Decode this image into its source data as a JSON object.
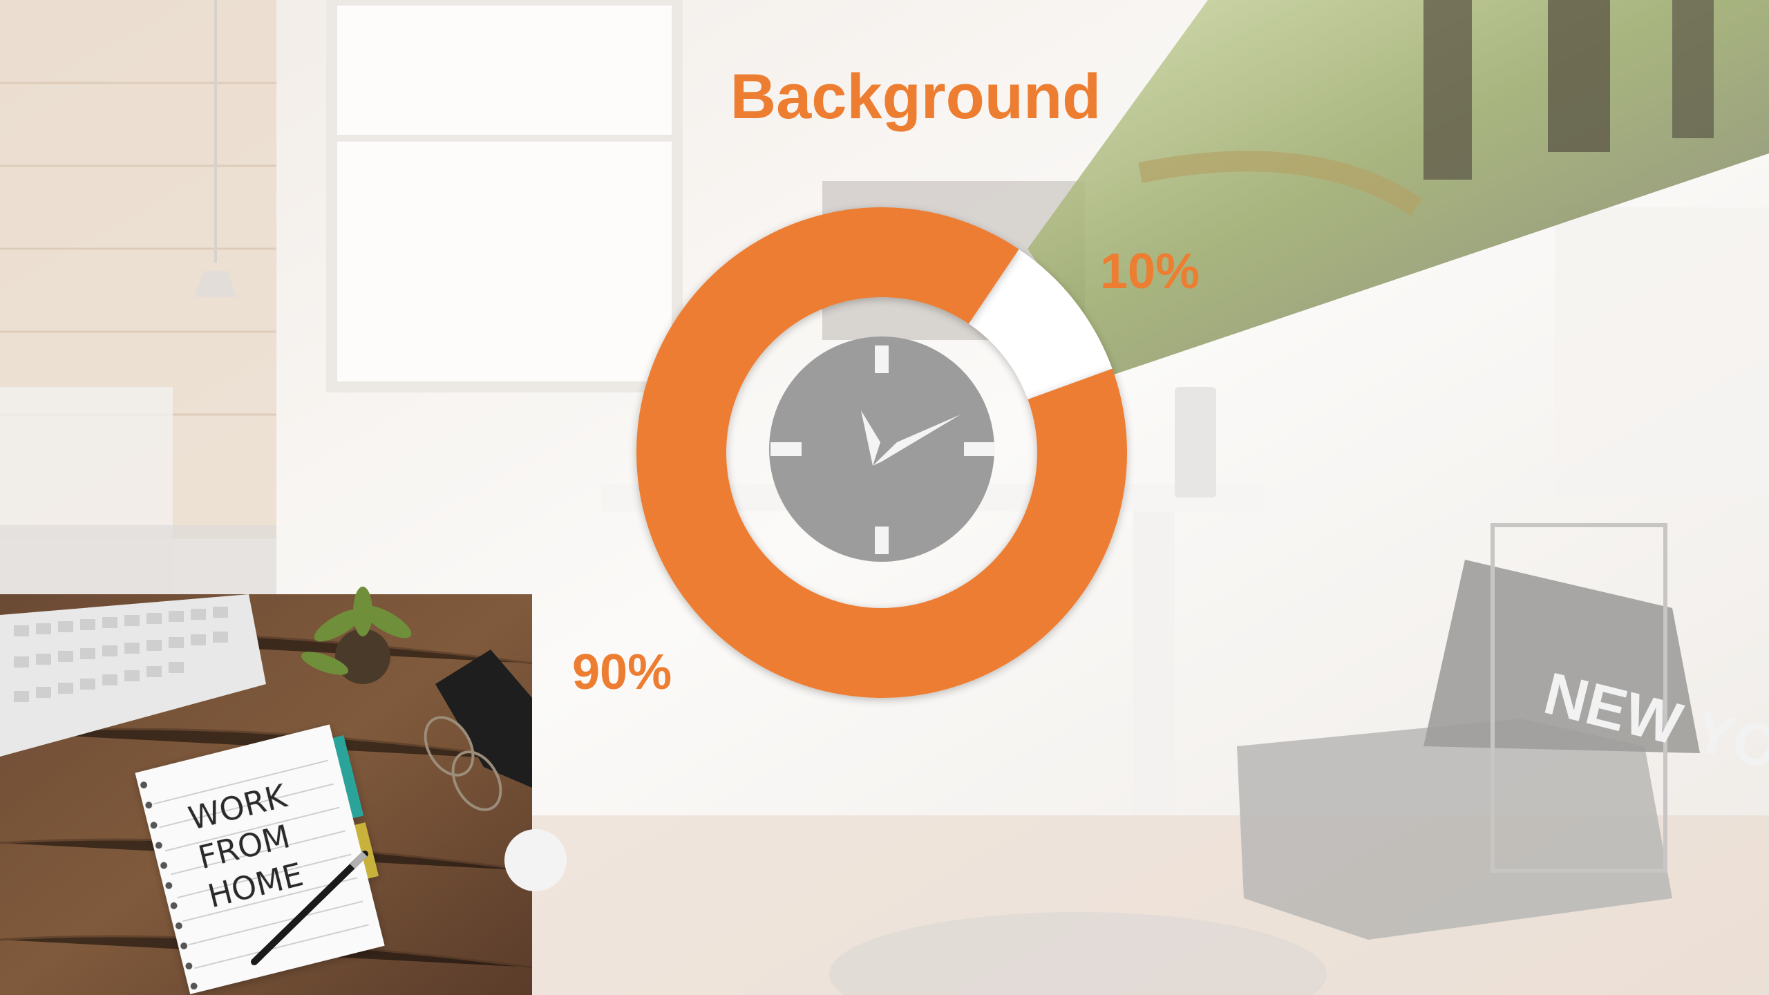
{
  "slide": {
    "title": "Background"
  },
  "photos": {
    "notebook_text": [
      "WORK",
      "FROM",
      "HOME"
    ],
    "pillow_text": "NEW YORK"
  },
  "chart_data": {
    "type": "pie",
    "categories": [
      "10%",
      "90%"
    ],
    "values": [
      10,
      90
    ],
    "labels": [
      "10%",
      "90%"
    ],
    "title": "Background",
    "colors": {
      "major_slice": "#ED7D31",
      "minor_slice": "#FFFFFF"
    },
    "center_icon": "clock-icon"
  },
  "colors": {
    "accent": "#ED7D31",
    "icon_gray": "#9C9C9C",
    "background": "#F6F3F0"
  }
}
